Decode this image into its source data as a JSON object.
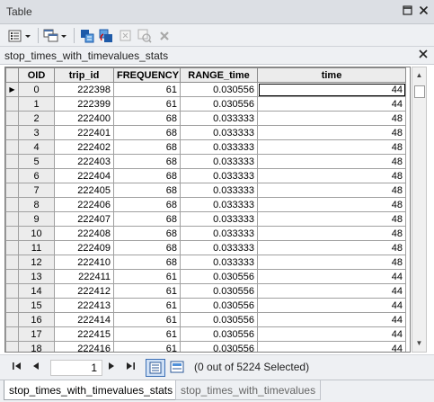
{
  "window": {
    "title": "Table"
  },
  "table_name": "stop_times_with_timevalues_stats",
  "columns": [
    "OID",
    "trip_id",
    "FREQUENCY",
    "RANGE_time",
    "time"
  ],
  "rows": [
    [
      "0",
      "222398",
      "61",
      "0.030556",
      "44"
    ],
    [
      "1",
      "222399",
      "61",
      "0.030556",
      "44"
    ],
    [
      "2",
      "222400",
      "68",
      "0.033333",
      "48"
    ],
    [
      "3",
      "222401",
      "68",
      "0.033333",
      "48"
    ],
    [
      "4",
      "222402",
      "68",
      "0.033333",
      "48"
    ],
    [
      "5",
      "222403",
      "68",
      "0.033333",
      "48"
    ],
    [
      "6",
      "222404",
      "68",
      "0.033333",
      "48"
    ],
    [
      "7",
      "222405",
      "68",
      "0.033333",
      "48"
    ],
    [
      "8",
      "222406",
      "68",
      "0.033333",
      "48"
    ],
    [
      "9",
      "222407",
      "68",
      "0.033333",
      "48"
    ],
    [
      "10",
      "222408",
      "68",
      "0.033333",
      "48"
    ],
    [
      "11",
      "222409",
      "68",
      "0.033333",
      "48"
    ],
    [
      "12",
      "222410",
      "68",
      "0.033333",
      "48"
    ],
    [
      "13",
      "222411",
      "61",
      "0.030556",
      "44"
    ],
    [
      "14",
      "222412",
      "61",
      "0.030556",
      "44"
    ],
    [
      "15",
      "222413",
      "61",
      "0.030556",
      "44"
    ],
    [
      "16",
      "222414",
      "61",
      "0.030556",
      "44"
    ],
    [
      "17",
      "222415",
      "61",
      "0.030556",
      "44"
    ],
    [
      "18",
      "222416",
      "61",
      "0.030556",
      "44"
    ]
  ],
  "current_row_marker": "▶",
  "navigation": {
    "current_record": "1",
    "selection_status": "(0 out of 5224 Selected)"
  },
  "bottom_tabs": [
    "stop_times_with_timevalues_stats",
    "stop_times_with_timevalues"
  ]
}
